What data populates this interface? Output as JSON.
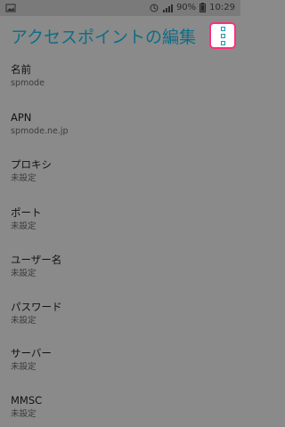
{
  "status_bar": {
    "left_icon": "image-icon",
    "battery_percent": "90%",
    "time": "10:29"
  },
  "header": {
    "title": "アクセスポイントの編集",
    "menu_icon": "overflow-menu-icon"
  },
  "items": [
    {
      "label": "名前",
      "value": "spmode"
    },
    {
      "label": "APN",
      "value": "spmode.ne.jp"
    },
    {
      "label": "プロキシ",
      "value": "未設定"
    },
    {
      "label": "ポート",
      "value": "未設定"
    },
    {
      "label": "ユーザー名",
      "value": "未設定"
    },
    {
      "label": "パスワード",
      "value": "未設定"
    },
    {
      "label": "サーバー",
      "value": "未設定"
    },
    {
      "label": "MMSC",
      "value": "未設定"
    }
  ]
}
